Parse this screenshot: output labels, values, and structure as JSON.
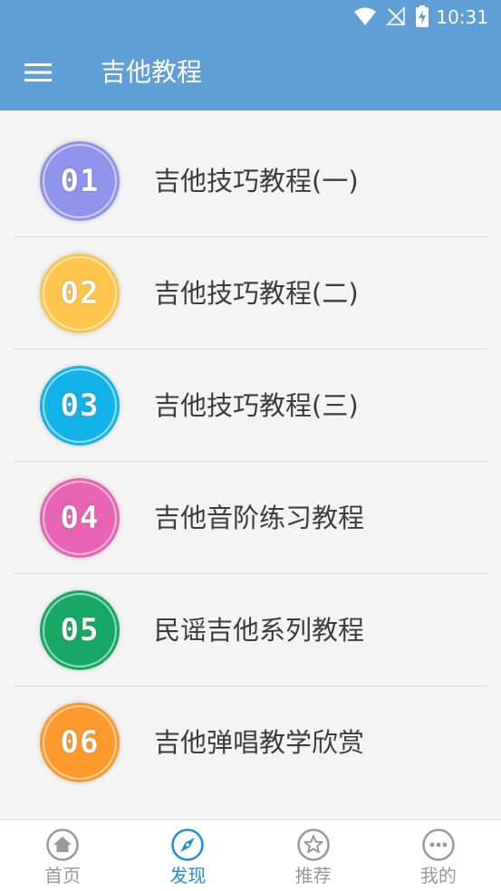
{
  "status_bar": {
    "time": "10:31",
    "icons": [
      "wifi-icon",
      "no-signal-icon",
      "battery-charging-icon"
    ]
  },
  "toolbar": {
    "menu_icon": "hamburger-menu-icon",
    "title": "吉他教程",
    "background_color": "#5f9fd6"
  },
  "list": {
    "items": [
      {
        "number": "01",
        "title": "吉他技巧教程(一)",
        "badge_color": "#8f93e9"
      },
      {
        "number": "02",
        "title": "吉他技巧教程(二)",
        "badge_color": "#fec54c"
      },
      {
        "number": "03",
        "title": "吉他技巧教程(三)",
        "badge_color": "#13b3e9"
      },
      {
        "number": "04",
        "title": "吉他音阶练习教程",
        "badge_color": "#e963b3"
      },
      {
        "number": "05",
        "title": "民谣吉他系列教程",
        "badge_color": "#18a865"
      },
      {
        "number": "06",
        "title": "吉他弹唱教学欣赏",
        "badge_color": "#fe9a2c"
      }
    ]
  },
  "bottom_nav": {
    "active_color": "#1f8fd8",
    "inactive_color": "#999999",
    "tabs": [
      {
        "label": "首页",
        "icon": "home-icon",
        "active": false
      },
      {
        "label": "发现",
        "icon": "compass-icon",
        "active": true
      },
      {
        "label": "推荐",
        "icon": "star-icon",
        "active": false
      },
      {
        "label": "我的",
        "icon": "more-dots-icon",
        "active": false
      }
    ]
  }
}
